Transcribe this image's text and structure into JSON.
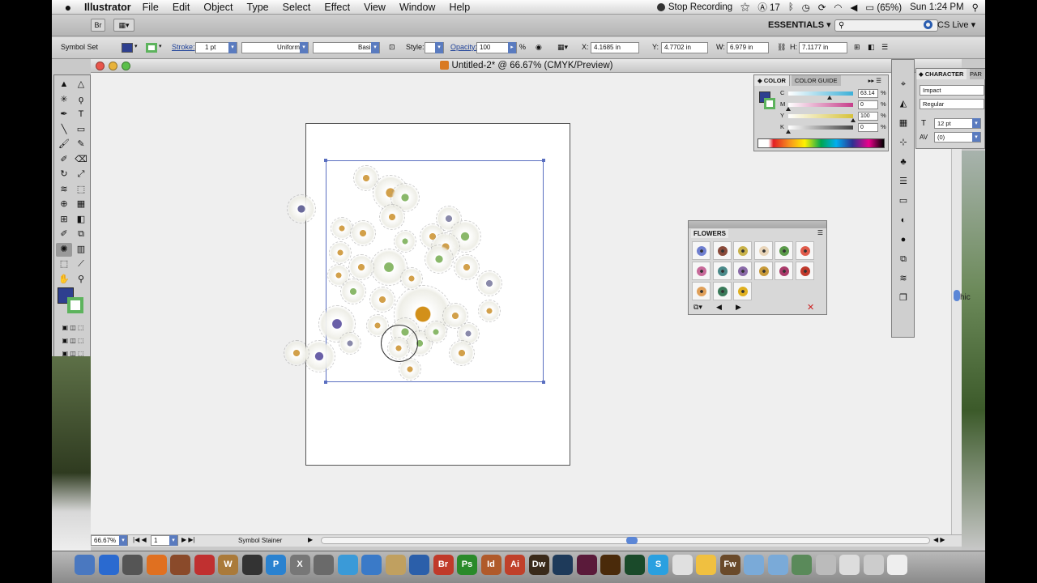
{
  "menubar": {
    "app_name": "Illustrator",
    "items": [
      "File",
      "Edit",
      "Object",
      "Type",
      "Select",
      "Effect",
      "View",
      "Window",
      "Help"
    ],
    "stop_recording": "Stop Recording",
    "adobe_badge": "17",
    "battery": "(65%)",
    "clock": "Sun 1:24 PM"
  },
  "appbar": {
    "workspace": "ESSENTIALS",
    "search_placeholder": "",
    "cs_live": "CS Live"
  },
  "control": {
    "selection_type": "Symbol Set",
    "fill_color": "#2e3f8f",
    "stroke_color": "#5db35d",
    "stroke_label": "Stroke:",
    "stroke_weight": "1 pt",
    "stroke_profile": "Uniform",
    "brush": "Basic",
    "style_label": "Style:",
    "opacity_label": "Opacity:",
    "opacity_value": "100",
    "opacity_unit": "%",
    "x_label": "X:",
    "x_value": "4.1685 in",
    "y_label": "Y:",
    "y_value": "4.7702 in",
    "w_label": "W:",
    "w_value": "6.979 in",
    "h_label": "H:",
    "h_value": "7.1177 in"
  },
  "document": {
    "title": "Untitled-2* @ 66.67% (CMYK/Preview)",
    "zoom": "66.67%",
    "artboard_number": "1",
    "status_tool": "Symbol Stainer"
  },
  "color_panel": {
    "tab_color": "COLOR",
    "tab_guide": "COLOR GUIDE",
    "channels": [
      {
        "label": "C",
        "value": "63.14",
        "unit": "%",
        "color": "#3cb0d8"
      },
      {
        "label": "M",
        "value": "0",
        "unit": "%",
        "color": "#c63e8a"
      },
      {
        "label": "Y",
        "value": "100",
        "unit": "%",
        "color": "#d6c23a"
      },
      {
        "label": "K",
        "value": "0",
        "unit": "%",
        "color": "#444444"
      }
    ]
  },
  "character_panel": {
    "tab": "CHARACTER",
    "tab2": "PAR",
    "font": "Impact",
    "style": "Regular",
    "size": "12 pt",
    "tracking": "(0)"
  },
  "flowers_panel": {
    "title": "FLOWERS"
  },
  "wallpaper_text": "hic",
  "dock_apps": [
    "Br",
    "Ps",
    "Id",
    "Ai",
    "Dw",
    "Fw",
    "W",
    "X"
  ]
}
